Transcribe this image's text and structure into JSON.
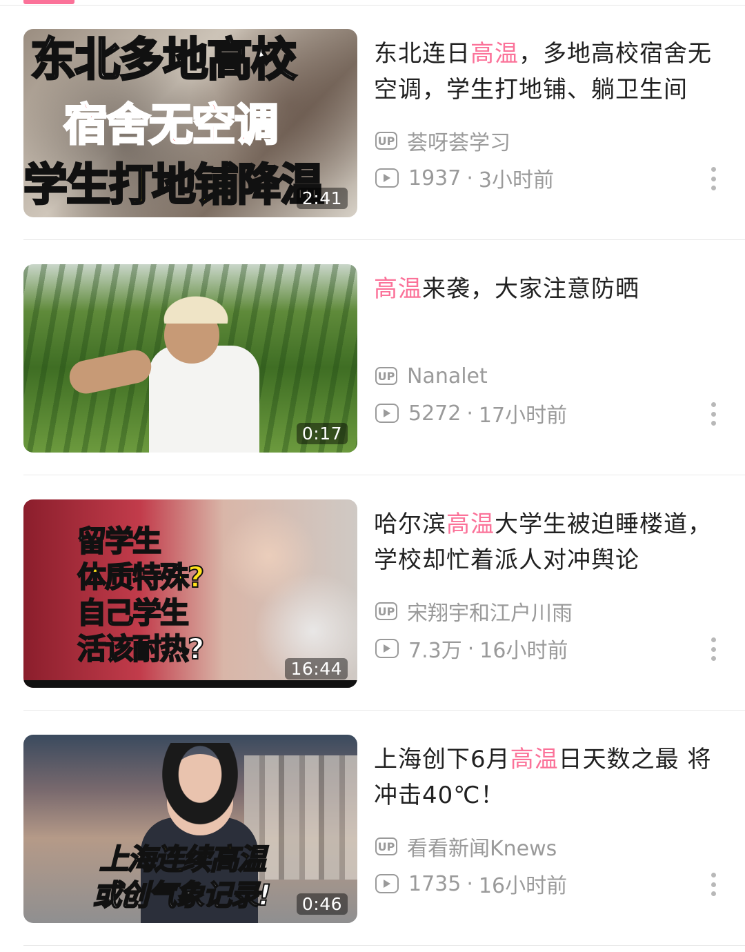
{
  "colors": {
    "accent": "#fb7299",
    "meta": "#9a9a9a"
  },
  "videos": [
    {
      "title_parts": [
        "东北连日",
        "高温",
        "，多地高校宿舍无空调，学生打地铺、躺卫生间"
      ],
      "uploader": "荟呀荟学习",
      "views": "1937",
      "time": "3小时前",
      "duration": "2:41",
      "thumb_text": [
        "东北多地高校",
        "宿舍无空调",
        "学生打地铺降温"
      ]
    },
    {
      "title_parts": [
        "",
        "高温",
        "来袭，大家注意防晒"
      ],
      "uploader": "Nanalet",
      "views": "5272",
      "time": "17小时前",
      "duration": "0:17",
      "thumb_text": []
    },
    {
      "title_parts": [
        "哈尔滨",
        "高温",
        "大学生被迫睡楼道，学校却忙着派人对冲舆论"
      ],
      "uploader": "宋翔宇和江户川雨",
      "views": "7.3万",
      "time": "16小时前",
      "duration": "16:44",
      "thumb_text": [
        "留学生",
        "体质特殊?",
        "自己学生",
        "活该耐热?"
      ]
    },
    {
      "title_parts": [
        "上海创下6月",
        "高温",
        "日天数之最 将冲击40℃！"
      ],
      "uploader": "看看新闻Knews",
      "views": "1735",
      "time": "16小时前",
      "duration": "0:46",
      "thumb_text": [
        "上海连续高温",
        "或创气象记录!"
      ]
    }
  ],
  "icons": {
    "up": "UP",
    "play": "play-icon",
    "more": "more-vertical-icon"
  }
}
